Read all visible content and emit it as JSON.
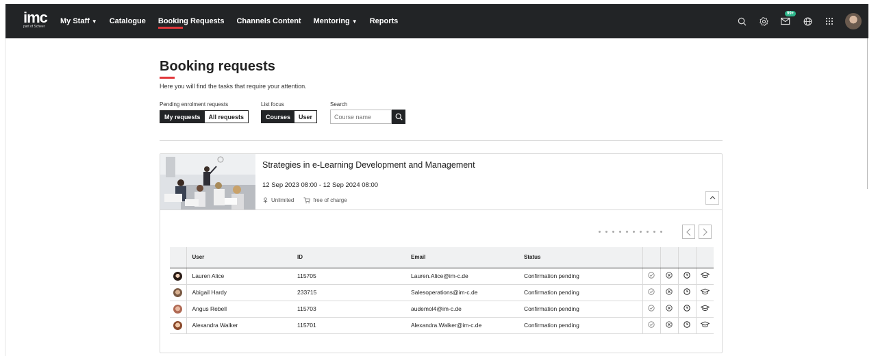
{
  "topbar": {
    "logo_text": "imc",
    "logo_sub": "part of Scheer",
    "nav": [
      {
        "label": "My Staff",
        "dropdown": true
      },
      {
        "label": "Catalogue",
        "dropdown": false
      },
      {
        "label": "Booking Requests",
        "dropdown": false,
        "active": true
      },
      {
        "label": "Channels Content",
        "dropdown": false
      },
      {
        "label": "Mentoring",
        "dropdown": true
      },
      {
        "label": "Reports",
        "dropdown": false
      }
    ],
    "icons": [
      "search-icon",
      "gear-icon",
      "mail-icon",
      "globe-icon",
      "apps-grid-icon",
      "avatar"
    ],
    "mail_badge": "99+"
  },
  "page": {
    "title": "Booking requests",
    "subtitle": "Here you will find the tasks that require your attention."
  },
  "filters": {
    "pending_label": "Pending enrolment requests",
    "pending_options": [
      "My requests",
      "All requests"
    ],
    "pending_selected": "My requests",
    "focus_label": "List focus",
    "focus_options": [
      "Courses",
      "User"
    ],
    "focus_selected": "Courses",
    "search_label": "Search",
    "search_placeholder": "Course name"
  },
  "course": {
    "title": "Strategies in e-Learning Development and Management",
    "dates": "12 Sep 2023 08:00 - 12 Sep 2024 08:00",
    "capacity": "Unlimited",
    "price": "free of charge"
  },
  "table": {
    "columns": [
      "User",
      "ID",
      "Email",
      "Status"
    ],
    "rows": [
      {
        "user": "Lauren Alice",
        "id": "115705",
        "email": "Lauren.Alice@im-c.de",
        "status": "Confirmation pending"
      },
      {
        "user": "Abigail Hardy",
        "id": "233715",
        "email": "Salesoperations@im-c.de",
        "status": "Confirmation pending"
      },
      {
        "user": "Angus Rebell",
        "id": "115703",
        "email": "audemol4@im-c.de",
        "status": "Confirmation pending"
      },
      {
        "user": "Alexandra Walker",
        "id": "115701",
        "email": "Alexandra.Walker@im-c.de",
        "status": "Confirmation pending"
      }
    ],
    "row_actions": [
      "approve-icon",
      "reject-icon",
      "waitlist-clock-icon",
      "course-cap-icon"
    ]
  },
  "colors": {
    "topbar": "#222426",
    "accent": "#e2363a",
    "badge": "#2db58a"
  }
}
